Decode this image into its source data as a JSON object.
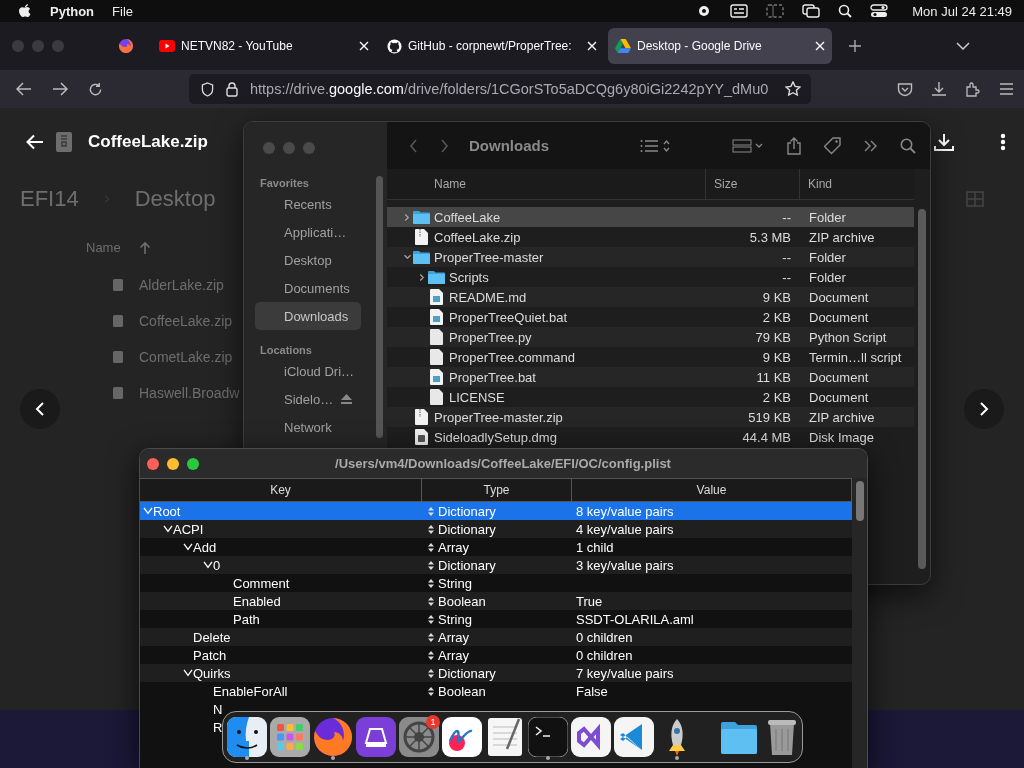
{
  "menubar": {
    "app": "Python",
    "menus": [
      "File"
    ],
    "clock": "Mon Jul 24 21:49"
  },
  "browser": {
    "tabs": [
      {
        "title": "NETVN82 - YouTube",
        "selected": false
      },
      {
        "title": "GitHub - corpnewt/ProperTree:",
        "selected": false
      },
      {
        "title": "Desktop - Google Drive",
        "selected": true
      }
    ],
    "url": {
      "prefix": "https://drive.",
      "domain": "google.com",
      "path": "/drive/folders/1CGorSTo5aDCQg6y80iGi2242pYY_dMu0"
    }
  },
  "drive": {
    "file_title": "CoffeeLake.zip",
    "breadcrumb": [
      "EFI14",
      "Desktop"
    ],
    "column": "Name",
    "files": [
      "AlderLake.zip",
      "CoffeeLake.zip",
      "CometLake.zip",
      "Haswell.Broadw"
    ]
  },
  "finder": {
    "title": "Downloads",
    "sidebar": [
      {
        "heading": "Favorites",
        "items": [
          {
            "label": "Recents",
            "selected": false,
            "ejectable": false
          },
          {
            "label": "Applicati…",
            "selected": false,
            "ejectable": false
          },
          {
            "label": "Desktop",
            "selected": false,
            "ejectable": false
          },
          {
            "label": "Documents",
            "selected": false,
            "ejectable": false
          },
          {
            "label": "Downloads",
            "selected": true,
            "ejectable": false
          }
        ]
      },
      {
        "heading": "Locations",
        "items": [
          {
            "label": "iCloud Dri…",
            "selected": false,
            "ejectable": false
          },
          {
            "label": "Sidelo…",
            "selected": false,
            "ejectable": true
          },
          {
            "label": "Network",
            "selected": false,
            "ejectable": false
          }
        ]
      }
    ],
    "columns": [
      "Name",
      "Size",
      "Kind"
    ],
    "rows": [
      {
        "kind": "folder",
        "name": "CoffeeLake",
        "size": "--",
        "kind_text": "Folder",
        "selected": true,
        "expanded": false
      },
      {
        "kind": "archive",
        "name": "CoffeeLake.zip",
        "size": "5.3 MB",
        "kind_text": "ZIP archive",
        "selected": false
      },
      {
        "kind": "folder",
        "name": "ProperTree-master",
        "size": "--",
        "kind_text": "Folder",
        "selected": false,
        "expanded": true,
        "children": [
          {
            "kind": "folder",
            "name": "Scripts",
            "size": "--",
            "kind_text": "Folder",
            "selected": false,
            "expanded": false
          },
          {
            "kind": "document",
            "name": "README.md",
            "size": "9 KB",
            "kind_text": "Document",
            "selected": false
          },
          {
            "kind": "document",
            "name": "ProperTreeQuiet.bat",
            "size": "2 KB",
            "kind_text": "Document",
            "selected": false
          },
          {
            "kind": "file",
            "name": "ProperTree.py",
            "size": "79 KB",
            "kind_text": "Python Script",
            "selected": false
          },
          {
            "kind": "file",
            "name": "ProperTree.command",
            "size": "9 KB",
            "kind_text": "Termin…ll script",
            "selected": false
          },
          {
            "kind": "document",
            "name": "ProperTree.bat",
            "size": "11 KB",
            "kind_text": "Document",
            "selected": false
          },
          {
            "kind": "file",
            "name": "LICENSE",
            "size": "2 KB",
            "kind_text": "Document",
            "selected": false
          }
        ]
      },
      {
        "kind": "archive",
        "name": "ProperTree-master.zip",
        "size": "519 KB",
        "kind_text": "ZIP archive",
        "selected": false
      },
      {
        "kind": "disk",
        "name": "SideloadlySetup.dmg",
        "size": "44.4 MB",
        "kind_text": "Disk Image",
        "selected": false
      }
    ]
  },
  "plist": {
    "title": "/Users/vm4/Downloads/CoffeeLake/EFI/OC/config.plist",
    "columns": [
      "Key",
      "Type",
      "Value"
    ],
    "rows": [
      {
        "key": "Root",
        "type": "Dictionary",
        "value": "8 key/value pairs",
        "selected": true,
        "expanded": true,
        "children": [
          {
            "key": "ACPI",
            "type": "Dictionary",
            "value": "4 key/value pairs",
            "selected": false,
            "expanded": true,
            "children": [
              {
                "key": "Add",
                "type": "Array",
                "value": "1 child",
                "selected": false,
                "expanded": true,
                "children": [
                  {
                    "key": "0",
                    "type": "Dictionary",
                    "value": "3 key/value pairs",
                    "selected": false,
                    "expanded": true,
                    "children": [
                      {
                        "key": "Comment",
                        "type": "String",
                        "selected": false
                      },
                      {
                        "key": "Enabled",
                        "type": "Boolean",
                        "value": "True",
                        "selected": false
                      },
                      {
                        "key": "Path",
                        "type": "String",
                        "value": "SSDT-OLARILA.aml",
                        "selected": false
                      }
                    ]
                  }
                ]
              },
              {
                "key": "Delete",
                "type": "Array",
                "value": "0 children",
                "selected": false
              },
              {
                "key": "Patch",
                "type": "Array",
                "value": "0 children",
                "selected": false
              },
              {
                "key": "Quirks",
                "type": "Dictionary",
                "value": "7 key/value pairs",
                "selected": false,
                "expanded": true,
                "children": [
                  {
                    "key": "EnableForAll",
                    "type": "Boolean",
                    "value": "False",
                    "selected": false
                  },
                  {
                    "key": "N",
                    "selected": false
                  },
                  {
                    "key": "R",
                    "selected": false
                  }
                ]
              }
            ]
          }
        ]
      }
    ]
  },
  "dock": {
    "apps": [
      {
        "running": true
      },
      {
        "running": false
      },
      {
        "running": true
      },
      {
        "running": false
      },
      {
        "running": false,
        "badge": "1"
      },
      {
        "running": false
      },
      {
        "running": false
      },
      {
        "running": true
      },
      {
        "running": false
      },
      {
        "running": false
      },
      {
        "running": true
      }
    ],
    "others": [
      {
        "running": false
      },
      {
        "running": false
      }
    ]
  }
}
